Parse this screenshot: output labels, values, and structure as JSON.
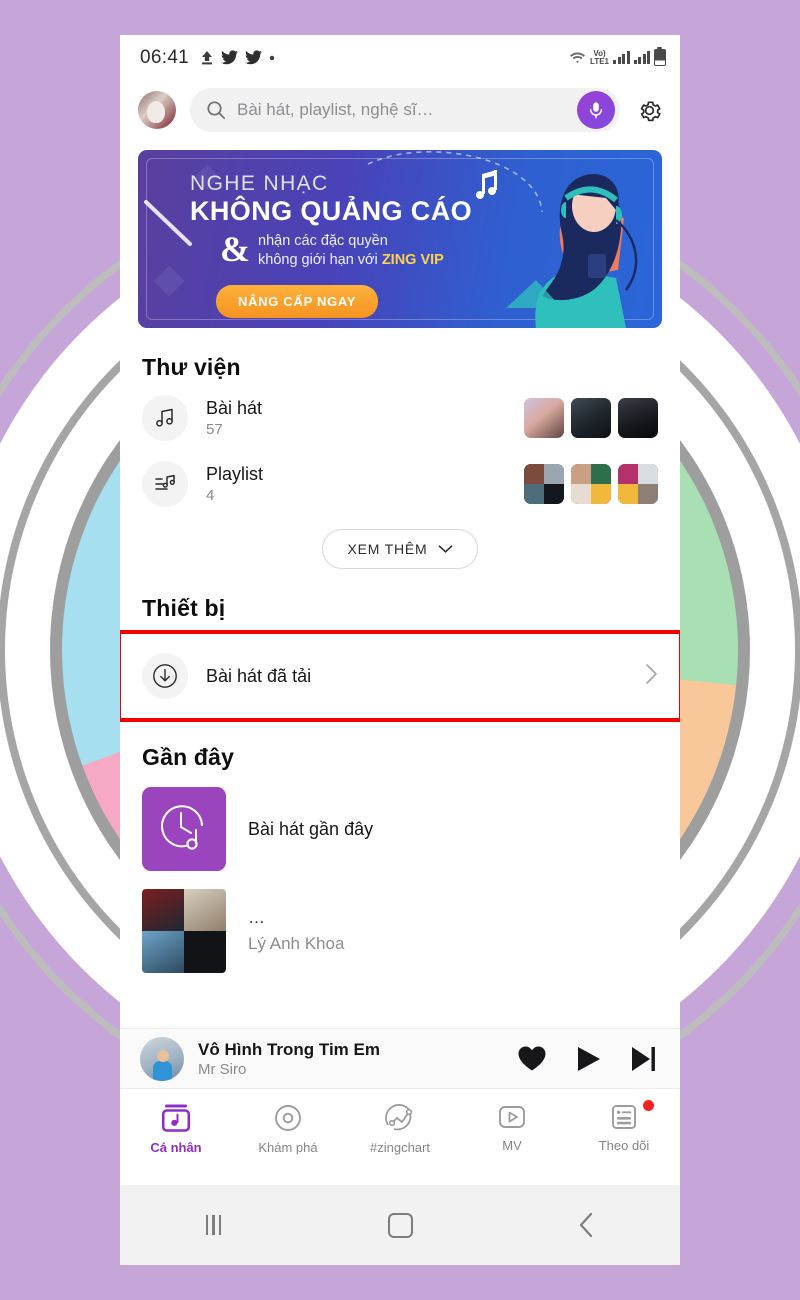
{
  "statusbar": {
    "time": "06:41",
    "icons_left": [
      "upload-icon",
      "twitter-icon",
      "twitter-icon",
      "dot-icon"
    ],
    "network_label_top": "Vo)",
    "network_label_bottom": "LTE1",
    "icons_right": [
      "wifi-icon",
      "volte-icon",
      "signal-icon",
      "signal-icon",
      "battery-icon"
    ]
  },
  "header": {
    "avatar": "user-avatar",
    "search_placeholder": "Bài hát, playlist, nghệ sĩ…",
    "search_icon": "search-icon",
    "mic_icon": "microphone-icon",
    "settings_icon": "gear-icon"
  },
  "banner": {
    "line1": "NGHE NHẠC",
    "line2": "KHÔNG QUẢNG CÁO",
    "ampersand": "&",
    "line3a": "nhận các đặc quyền",
    "line3b": "không giới hạn với ",
    "brand": "ZING VIP",
    "cta": "NÂNG CẤP NGAY",
    "accent_color": "#ffd24d",
    "cta_color": "#f59321"
  },
  "library": {
    "title": "Thư viện",
    "items": [
      {
        "name": "Bài hát",
        "count": "57",
        "icon": "music-note-icon"
      },
      {
        "name": "Playlist",
        "count": "4",
        "icon": "playlist-icon"
      }
    ],
    "more_button": "XEM THÊM",
    "more_icon": "chevron-down-icon"
  },
  "device": {
    "title": "Thiết bị",
    "row_label": "Bài hát đã tải",
    "row_icon": "download-circle-icon",
    "chevron": "chevron-right-icon",
    "highlight_color": "#f40000"
  },
  "recent": {
    "title": "Gần đây",
    "items": [
      {
        "label": "Bài hát gần đây",
        "icon": "recent-clock-music-icon",
        "tile_color": "#9a44bd"
      },
      {
        "label": "…",
        "sub": "Lý Anh Khoa",
        "icon": "album-grid-icon"
      }
    ]
  },
  "player": {
    "title": "Vô Hình Trong Tim Em",
    "artist": "Mr Siro",
    "controls": [
      "heart-icon",
      "play-icon",
      "next-icon"
    ]
  },
  "bottom_nav": {
    "items": [
      {
        "label": "Cá nhân",
        "icon": "personal-icon",
        "active": true,
        "badge": false
      },
      {
        "label": "Khám phá",
        "icon": "discover-icon",
        "active": false,
        "badge": false
      },
      {
        "label": "#zingchart",
        "icon": "chart-icon",
        "active": false,
        "badge": false
      },
      {
        "label": "MV",
        "icon": "mv-icon",
        "active": false,
        "badge": false
      },
      {
        "label": "Theo dõi",
        "icon": "following-icon",
        "active": false,
        "badge": true
      }
    ],
    "active_color": "#8c2fc7",
    "badge_color": "#f82121"
  },
  "android_nav": {
    "recents": "recents-icon",
    "home": "home-icon",
    "back": "back-icon"
  }
}
